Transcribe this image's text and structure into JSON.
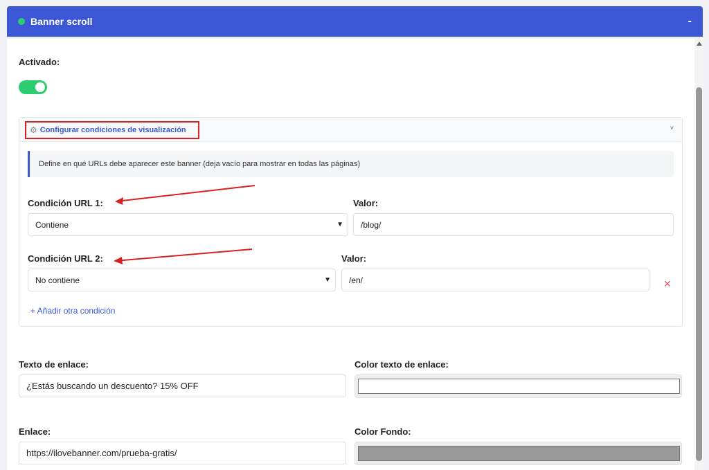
{
  "header": {
    "title": "Banner scroll",
    "collapse_label": "-"
  },
  "activated": {
    "label": "Activado:",
    "enabled": true
  },
  "conditions": {
    "title": "Configurar condiciones de visualización",
    "info": "Define en qué URLs debe aparecer este banner (deja vacío para mostrar en todas las páginas)",
    "rows": [
      {
        "condition_label": "Condición URL 1:",
        "condition_value": "Contiene",
        "value_label": "Valor:",
        "value": "/blog/"
      },
      {
        "condition_label": "Condición URL 2:",
        "condition_value": "No contiene",
        "value_label": "Valor:",
        "value": "/en/"
      }
    ],
    "add_label": "+ Añadir otra condición"
  },
  "link_text": {
    "label": "Texto de enlace:",
    "value": "¿Estás buscando un descuento? 15% OFF"
  },
  "link_text_color": {
    "label": "Color texto de enlace:",
    "color": "#ffffff"
  },
  "link": {
    "label": "Enlace:",
    "value": "https://ilovebanner.com/prueba-gratis/"
  },
  "bg_color": {
    "label": "Color Fondo:",
    "color": "#999999"
  },
  "colors": {
    "accent": "#3b57d6",
    "toggle_on": "#2ecc71",
    "annotation": "#d92020"
  }
}
